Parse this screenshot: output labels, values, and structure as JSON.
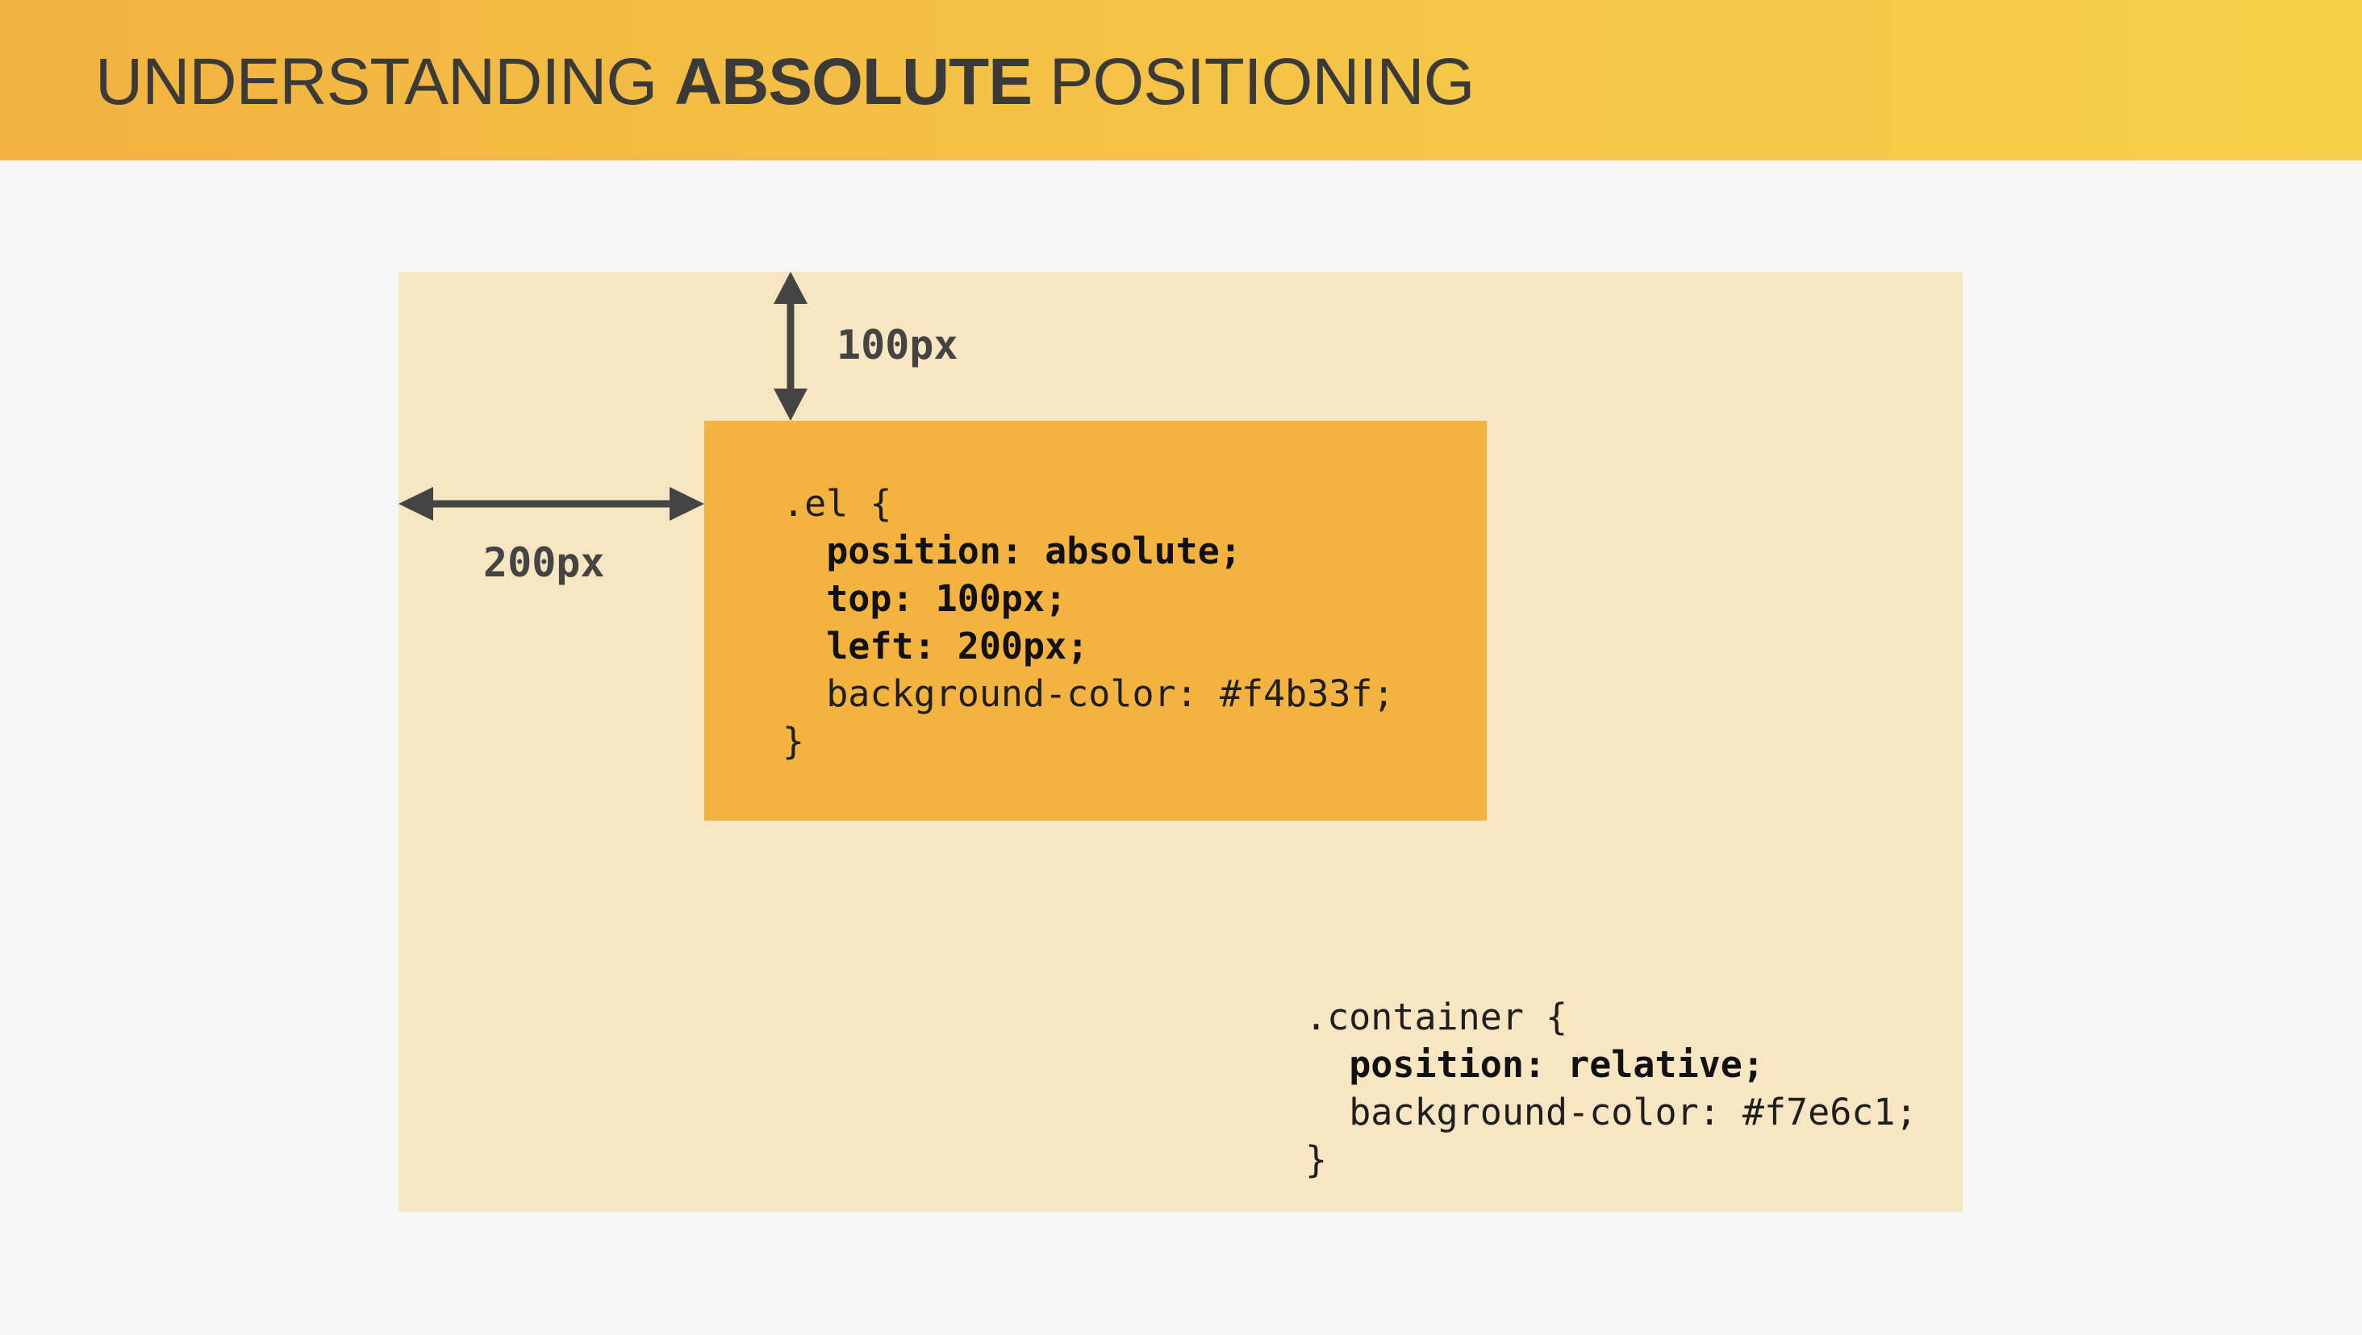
{
  "header": {
    "title_prefix": "UNDERSTANDING",
    "title_bold": "ABSOLUTE",
    "title_suffix": "POSITIONING"
  },
  "diagram": {
    "top_offset_label": "100px",
    "left_offset_label": "200px",
    "el_code": {
      "selector_open": ".el {",
      "prop_position": "position: absolute;",
      "prop_top": "top: 100px;",
      "prop_left": "left: 200px;",
      "prop_background": "background-color: #f4b33f;",
      "close": "}"
    },
    "container_code": {
      "selector_open": ".container {",
      "prop_position": "position: relative;",
      "prop_background": "background-color: #f7e6c1;",
      "close": "}"
    }
  },
  "colors": {
    "header_start": "#f2b33f",
    "header_end": "#f7d049",
    "page_background": "#f7f7f7",
    "container_background": "#f7e6c1",
    "el_background": "#f4b33f",
    "arrow": "#444444"
  }
}
